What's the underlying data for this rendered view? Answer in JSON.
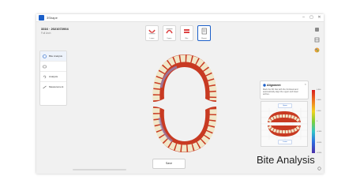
{
  "window": {
    "app_name": "3Shape",
    "controls": [
      "–",
      "▢",
      "✕"
    ],
    "case_id": "3316 · 2021072004",
    "case_sub": "Full Arch"
  },
  "toolbar": {
    "tools": [
      {
        "label": "Lower",
        "icon": "lower-arch-icon"
      },
      {
        "label": "Upper",
        "icon": "upper-arch-icon"
      },
      {
        "label": "Bite",
        "icon": "bite-icon"
      },
      {
        "label": "Report",
        "icon": "report-icon"
      }
    ]
  },
  "right_icons": [
    "view-cube-icon",
    "layers-icon",
    "color-palette-icon"
  ],
  "left_panel": {
    "items": [
      {
        "label": "Bite Analysis",
        "icon": "bite-analysis-icon",
        "active": true
      },
      {
        "label": "",
        "icon": "tooth-icon",
        "active": false
      },
      {
        "label": "Analysis",
        "icon": "analysis-icon",
        "active": false
      },
      {
        "label": "Measurement",
        "icon": "measurement-icon",
        "active": false
      }
    ]
  },
  "alignment_panel": {
    "title": "Alignment",
    "description": "Mark the 3D bite with the Occlusal and automatically align the upper and lower arches.",
    "upper_button": "Upper",
    "lower_button": "Lower"
  },
  "color_scale": {
    "labels": [
      "0.900",
      "0.600",
      "0.300",
      "0",
      "-0.300",
      "-0.600",
      "-0.900"
    ],
    "colors": [
      "#d81e1e",
      "#ef7b1f",
      "#f0d21e",
      "#7ccf3a",
      "#2fc3c8",
      "#2c6de0",
      "#4b2ea8"
    ]
  },
  "save_button": "Save",
  "caption": "Bite Analysis"
}
